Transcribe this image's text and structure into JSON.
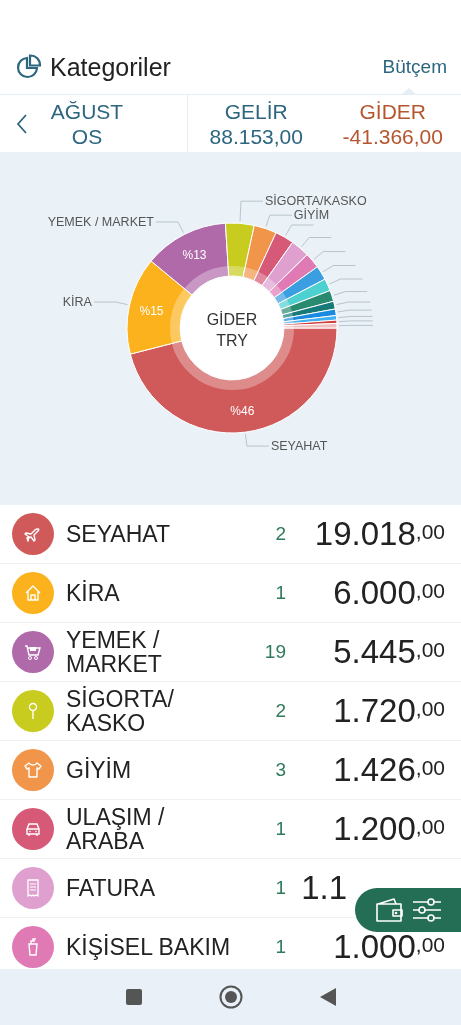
{
  "header": {
    "title": "Kategoriler",
    "tab": "Bütçem"
  },
  "period": {
    "month": "AĞUSTOS",
    "income_label": "GELİR",
    "income": "88.153,00",
    "expense_label": "GİDER",
    "expense": "-41.366,00"
  },
  "chart": {
    "center_title": "GİDER",
    "center_subtitle": "TRY",
    "chart_data": {
      "type": "donut",
      "categories": [
        "SEYAHAT",
        "KİRA",
        "YEMEK / MARKET",
        "SİGORTA/KASKO",
        "GİYİM",
        null,
        null,
        null,
        null,
        null,
        null,
        null,
        null,
        null,
        null,
        null
      ],
      "values": [
        46,
        15,
        13,
        4.4,
        3.5,
        2.9,
        2.9,
        2.4,
        2.2,
        1.9,
        1.7,
        1.2,
        1.0,
        0.7,
        0.5,
        0.7
      ],
      "colors": [
        "#d05a5a",
        "#fbb21c",
        "#b06aaa",
        "#c8cc1e",
        "#f0954a",
        "#d65a78",
        "#dfa0d0",
        "#e07ab5",
        "#3a9ee0",
        "#4fd0d0",
        "#2a8a70",
        "#167a78",
        "#1a8ae0",
        "#40b0f0",
        "#d04040",
        "#f0c0c0"
      ],
      "value_labels": [
        "%46",
        "%15",
        "%13",
        null,
        null,
        null,
        null,
        null,
        null,
        null,
        null,
        null,
        null,
        null,
        null,
        null
      ]
    }
  },
  "categories": [
    {
      "name": "SEYAHAT",
      "count": "2",
      "amount": "19.018",
      "decimals": ",00",
      "color": "#d05a5a"
    },
    {
      "name": "KİRA",
      "count": "1",
      "amount": "6.000",
      "decimals": ",00",
      "color": "#fbb21c"
    },
    {
      "name": "YEMEK / MARKET",
      "count": "19",
      "amount": "5.445",
      "decimals": ",00",
      "color": "#b06aaa"
    },
    {
      "name": "SİGORTA/ KASKO",
      "count": "2",
      "amount": "1.720",
      "decimals": ",00",
      "color": "#c8cc1e"
    },
    {
      "name": "GİYİM",
      "count": "3",
      "amount": "1.426",
      "decimals": ",00",
      "color": "#f0954a"
    },
    {
      "name": "ULAŞIM / ARABA",
      "count": "1",
      "amount": "1.200",
      "decimals": ",00",
      "color": "#d65a78"
    },
    {
      "name": "FATURA",
      "count": "1",
      "amount": "1.1",
      "color": "#dfa0d0"
    },
    {
      "name": "KİŞİSEL BAKIM",
      "count": "1",
      "amount": "1.000",
      "decimals": ",00",
      "color": "#e07ab5"
    }
  ]
}
